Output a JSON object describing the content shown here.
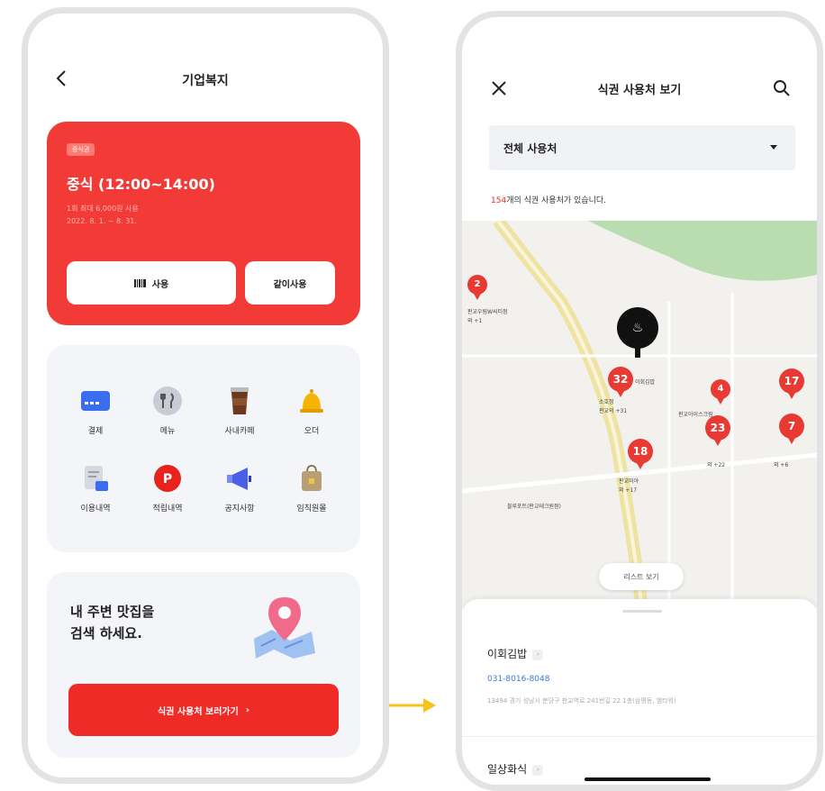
{
  "left_screen": {
    "header": {
      "title": "기업복지"
    },
    "meal_card": {
      "badge": "중식권",
      "title": "중식 (12:00~14:00)",
      "sub1": "1회 최대 6,000원 사용",
      "sub2": "2022. 8. 1. ~ 8. 31.",
      "use_button": "사용",
      "share_button": "같이사용"
    },
    "menu": [
      {
        "label": "결제",
        "icon": "card-icon"
      },
      {
        "label": "메뉴",
        "icon": "utensils-icon"
      },
      {
        "label": "사내카페",
        "icon": "coffee-icon"
      },
      {
        "label": "오더",
        "icon": "bell-icon"
      },
      {
        "label": "이용내역",
        "icon": "receipt-icon"
      },
      {
        "label": "적립내역",
        "icon": "point-icon"
      },
      {
        "label": "공지사항",
        "icon": "megaphone-icon"
      },
      {
        "label": "임직원몰",
        "icon": "shopping-bag-icon"
      }
    ],
    "nearby": {
      "line1": "내 주변 맛집을",
      "line2": "검색 하세요.",
      "button": "식권 사용처 보러가기"
    }
  },
  "right_screen": {
    "header": {
      "title": "식권 사용처 보기"
    },
    "dropdown": {
      "selected": "전체 사용처"
    },
    "count": {
      "number": "154",
      "suffix": "개의 식권 사용처가 있습니다."
    },
    "map": {
      "pins": [
        "2",
        "32",
        "4",
        "17",
        "23",
        "7",
        "18"
      ],
      "labels": [
        "판교우림W씨티점",
        "외 +1",
        "이회김밥",
        "소호정",
        "판교의 +31",
        "판교아이스크림",
        "외 +22",
        "외 +6",
        "판교미야",
        "외 +17",
        "블루포트(판교테크원점)"
      ],
      "list_button": "리스트 보기"
    },
    "sheet": {
      "store1_name": "이회김밥",
      "store1_phone": "031-8016-8048",
      "store1_address": "13494 경기 성남시 분당구 판교역로 241번길 22 1층(삼평동, 엠타워)",
      "store2_name": "일상화식"
    }
  },
  "colors": {
    "accent": "#ee2b27",
    "card": "#f23b37",
    "panel": "#f4f5f8",
    "link": "#3a7bd5",
    "highlight": "#f7d21e"
  }
}
